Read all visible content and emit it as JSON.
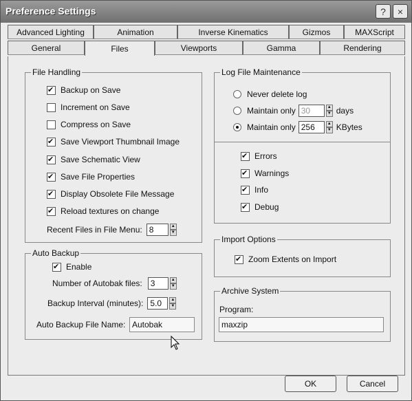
{
  "window": {
    "title": "Preference Settings"
  },
  "title_buttons": {
    "help_icon": "?",
    "close_icon": "×"
  },
  "tabs": {
    "row1": [
      "Advanced Lighting",
      "Animation",
      "Inverse Kinematics",
      "Gizmos",
      "MAXScript"
    ],
    "row2": [
      "General",
      "Files",
      "Viewports",
      "Gamma",
      "Rendering"
    ],
    "active": "Files"
  },
  "file_handling": {
    "legend": "File Handling",
    "options": [
      {
        "label": "Backup on Save",
        "checked": true
      },
      {
        "label": "Increment on Save",
        "checked": false
      },
      {
        "label": "Compress on Save",
        "checked": false
      },
      {
        "label": "Save Viewport Thumbnail Image",
        "checked": true
      },
      {
        "label": "Save Schematic View",
        "checked": true
      },
      {
        "label": "Save File Properties",
        "checked": true
      },
      {
        "label": "Display Obsolete File Message",
        "checked": true
      },
      {
        "label": "Reload textures on change",
        "checked": true
      }
    ],
    "recent_label": "Recent Files in File Menu:",
    "recent_value": "8"
  },
  "auto_backup": {
    "legend": "Auto Backup",
    "enable_label": "Enable",
    "enable_checked": true,
    "num_files_label": "Number of Autobak files:",
    "num_files_value": "3",
    "interval_label": "Backup Interval (minutes):",
    "interval_value": "5.0",
    "filename_label": "Auto Backup File Name:",
    "filename_value": "Autobak"
  },
  "log_file": {
    "legend": "Log File Maintenance",
    "never_label": "Never delete log",
    "maintain_days_label": "Maintain only",
    "days_value": "30",
    "days_unit": "days",
    "maintain_kb_label": "Maintain only",
    "kb_value": "256",
    "kb_unit": "KBytes",
    "selected": "kbytes",
    "levels": [
      {
        "label": "Errors",
        "checked": true
      },
      {
        "label": "Warnings",
        "checked": true
      },
      {
        "label": "Info",
        "checked": true
      },
      {
        "label": "Debug",
        "checked": true
      }
    ]
  },
  "import_options": {
    "legend": "Import Options",
    "zoom_label": "Zoom Extents on Import",
    "zoom_checked": true
  },
  "archive_system": {
    "legend": "Archive System",
    "program_label": "Program:",
    "program_value": "maxzip"
  },
  "buttons": {
    "ok": "OK",
    "cancel": "Cancel"
  }
}
